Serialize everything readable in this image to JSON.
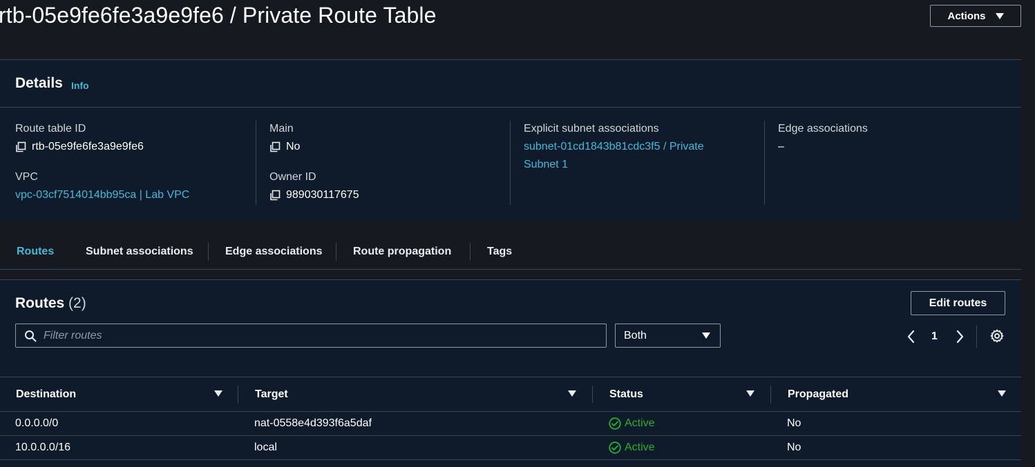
{
  "header": {
    "title": "rtb-05e9fe6fe3a9e9fe6 / Private Route Table",
    "actions_label": "Actions"
  },
  "details": {
    "title": "Details",
    "info_label": "Info",
    "route_table_id_label": "Route table ID",
    "route_table_id_value": "rtb-05e9fe6fe3a9e9fe6",
    "vpc_label": "VPC",
    "vpc_value": "vpc-03cf7514014bb95ca | Lab VPC",
    "main_label": "Main",
    "main_value": "No",
    "owner_id_label": "Owner ID",
    "owner_id_value": "989030117675",
    "explicit_subnet_label": "Explicit subnet associations",
    "explicit_subnet_value_line1": "subnet-01cd1843b81cdc3f5 / Private",
    "explicit_subnet_value_line2": "Subnet 1",
    "edge_associations_label": "Edge associations",
    "edge_associations_value": "–"
  },
  "tabs": [
    {
      "label": "Routes",
      "active": true
    },
    {
      "label": "Subnet associations",
      "active": false
    },
    {
      "label": "Edge associations",
      "active": false
    },
    {
      "label": "Route propagation",
      "active": false
    },
    {
      "label": "Tags",
      "active": false
    }
  ],
  "routes": {
    "title": "Routes",
    "count": "(2)",
    "edit_label": "Edit routes",
    "filter_placeholder": "Filter routes",
    "filter_select_value": "Both",
    "page_number": "1",
    "columns": [
      "Destination",
      "Target",
      "Status",
      "Propagated"
    ],
    "rows": [
      {
        "destination": "0.0.0.0/0",
        "target": "nat-0558e4d393f6a5daf",
        "target_is_link": true,
        "status": "Active",
        "propagated": "No"
      },
      {
        "destination": "10.0.0.0/16",
        "target": "local",
        "target_is_link": false,
        "status": "Active",
        "propagated": "No"
      }
    ]
  },
  "colors": {
    "page_bg": "#16191f",
    "panel_bg": "#0f1b2a",
    "link": "#44b9d6",
    "success": "#29ad32",
    "border": "#414750"
  },
  "icons": {
    "copy": "copy-icon",
    "search": "search-icon",
    "prev": "chevron-left-icon",
    "next": "chevron-right-icon",
    "settings": "gear-icon",
    "status": "check-circle-icon",
    "dropdown": "caret-down-icon",
    "sort": "sort-down-icon"
  }
}
